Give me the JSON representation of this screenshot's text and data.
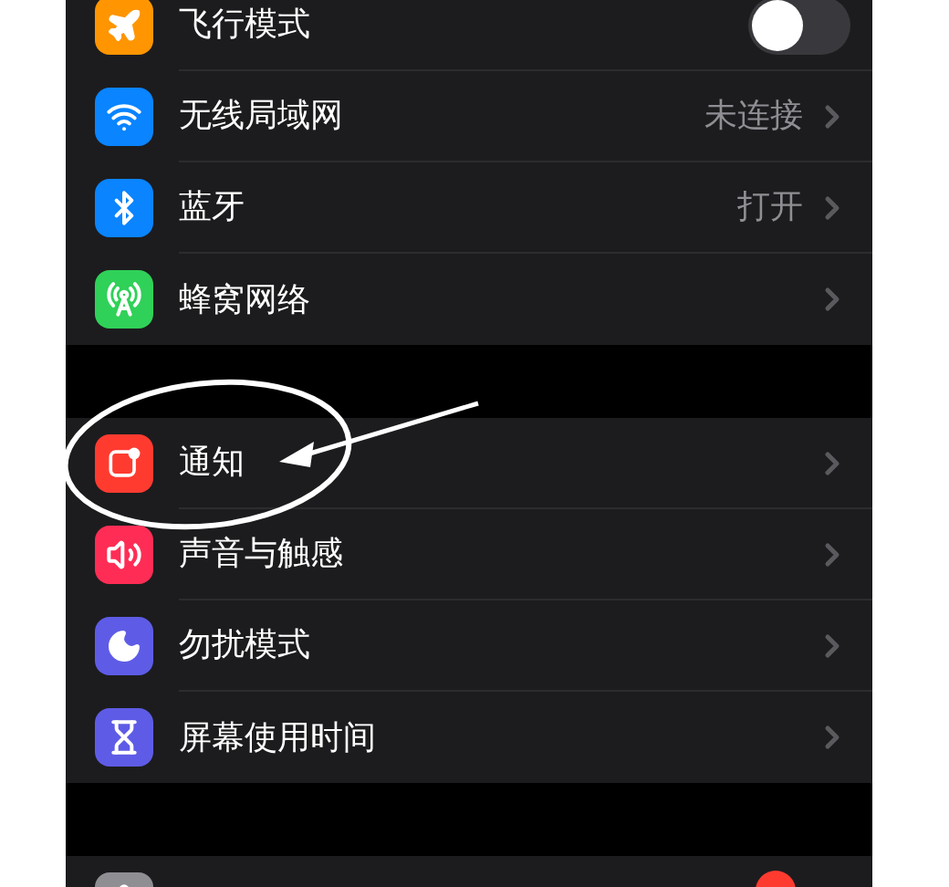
{
  "groups": [
    {
      "items": [
        {
          "kind": "toggle",
          "label": "飞行模式",
          "color": "#ff9500",
          "on": false
        },
        {
          "kind": "link",
          "label": "无线局域网",
          "color": "#0a84ff",
          "value": "未连接"
        },
        {
          "kind": "link",
          "label": "蓝牙",
          "color": "#0a84ff",
          "value": "打开"
        },
        {
          "kind": "link",
          "label": "蜂窝网络",
          "color": "#30d158"
        }
      ]
    },
    {
      "items": [
        {
          "kind": "link",
          "label": "通知",
          "color": "#ff3b30"
        },
        {
          "kind": "link",
          "label": "声音与触感",
          "color": "#ff2d55"
        },
        {
          "kind": "link",
          "label": "勿扰模式",
          "color": "#5e5ce6"
        },
        {
          "kind": "link",
          "label": "屏幕使用时间",
          "color": "#5e5ce6"
        }
      ]
    },
    {
      "items": [
        {
          "kind": "cut",
          "color": "#8e8e93",
          "badge": true
        }
      ]
    }
  ]
}
